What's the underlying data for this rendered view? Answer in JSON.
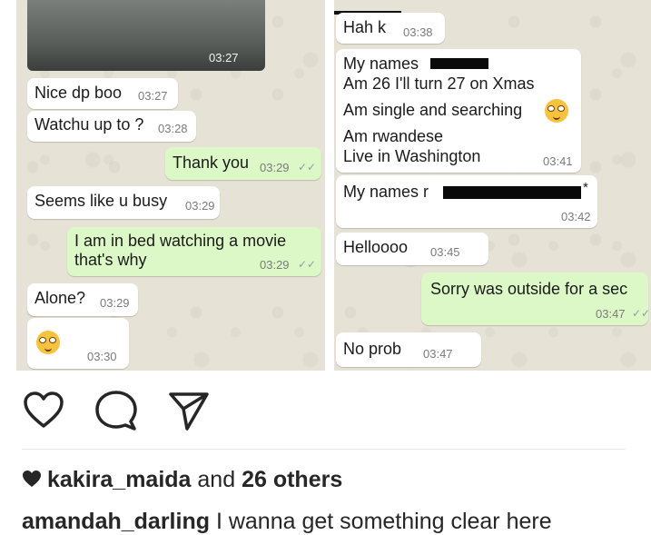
{
  "chat_screenshot": {
    "left_pane": {
      "photo_time": "03:27",
      "messages": [
        {
          "direction": "in",
          "text": "Nice dp boo",
          "time": "03:27"
        },
        {
          "direction": "in",
          "text": "Watchu up to ?",
          "time": "03:28"
        },
        {
          "direction": "out",
          "text": "Thank you",
          "time": "03:29",
          "ticks": "✓✓"
        },
        {
          "direction": "in",
          "text": "Seems like u busy",
          "time": "03:29"
        },
        {
          "direction": "out",
          "line1": "I am in bed watching a movie",
          "line2": "that's why",
          "time": "03:29",
          "ticks": "✓✓"
        },
        {
          "direction": "in",
          "text": "Alone?",
          "time": "03:29"
        },
        {
          "direction": "in",
          "emoji": "nerd-face-emoji",
          "time": "03:30"
        }
      ]
    },
    "right_pane": {
      "messages": [
        {
          "direction": "in",
          "text": "Hah k",
          "time": "03:38"
        },
        {
          "direction": "in",
          "line1": "My names",
          "line2": "Am 26 I'll turn 27 on Xmas",
          "line3": "Am single and searching",
          "line4": "Am rwandese",
          "line5": "Live in Washington",
          "time": "03:41",
          "emoji": "nerd-face-emoji"
        },
        {
          "direction": "in",
          "text": "My names r",
          "suffix": "*",
          "time": "03:42"
        },
        {
          "direction": "in",
          "text": "Helloooo",
          "time": "03:45"
        },
        {
          "direction": "out",
          "text": "Sorry was outside for a sec",
          "time": "03:47",
          "ticks": "✓✓"
        },
        {
          "direction": "in",
          "text": "No prob",
          "time": "03:47"
        }
      ]
    }
  },
  "post_actions": {
    "like_icon": "heart-outline-icon",
    "comment_icon": "comment-bubble-icon",
    "share_icon": "send-paper-plane-icon"
  },
  "likes": {
    "icon": "heart-filled-icon",
    "user": "kakira_maida",
    "connector": "and",
    "others": "26 others"
  },
  "caption": {
    "username": "amandah_darling",
    "text": "I wanna get something clear here"
  },
  "colors": {
    "outgoing_bubble": "#dcf8c6",
    "incoming_bubble": "#ffffff",
    "chat_background": "#e6e2d6"
  }
}
